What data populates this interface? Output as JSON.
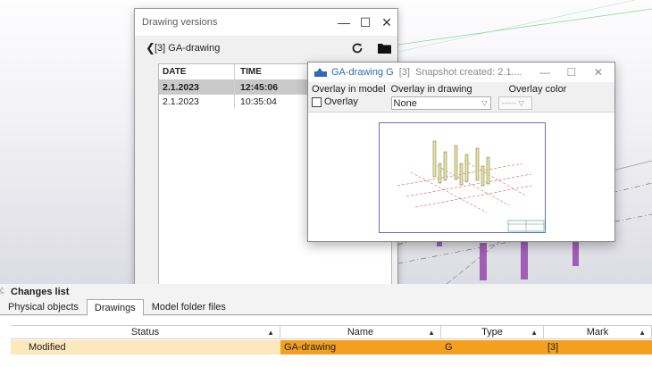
{
  "drawing_versions": {
    "title": "Drawing versions",
    "controls": {
      "minimize": "—",
      "maximize": "☐",
      "close": "✕"
    },
    "back": "❮",
    "drawing": "[3] GA-drawing",
    "refresh_icon": "refresh-icon",
    "folder_icon": "folder-icon",
    "columns": [
      "DATE",
      "TIME"
    ],
    "rows": [
      {
        "date": "2.1.2023",
        "time": "12:45:06",
        "selected": true
      },
      {
        "date": "2.1.2023",
        "time": "10:35:04",
        "selected": false
      }
    ]
  },
  "preview": {
    "title_name": "GA-drawing G",
    "title_mark": "[3]",
    "title_status": "Snapshot created: 2.1....",
    "controls": {
      "minimize": "—",
      "maximize": "☐",
      "close": "✕"
    },
    "overlay_model_label": "Overlay in model",
    "overlay_checkbox_label": "Overlay",
    "overlay_drawing_label": "Overlay in drawing",
    "overlay_drawing_value": "None",
    "overlay_color_label": "Overlay color",
    "overlay_color_value": "------",
    "dropdown_arrow": "▽"
  },
  "changes": {
    "title": "Changes list",
    "tabs": [
      "Physical objects",
      "Drawings",
      "Model folder files"
    ],
    "active_tab": "Drawings",
    "columns": [
      "Status",
      "Name",
      "Type",
      "Mark"
    ],
    "sort_glyph": "▲",
    "rows": [
      {
        "status": "Modified",
        "name": "GA-drawing",
        "type": "G",
        "mark": "[3]"
      }
    ]
  }
}
